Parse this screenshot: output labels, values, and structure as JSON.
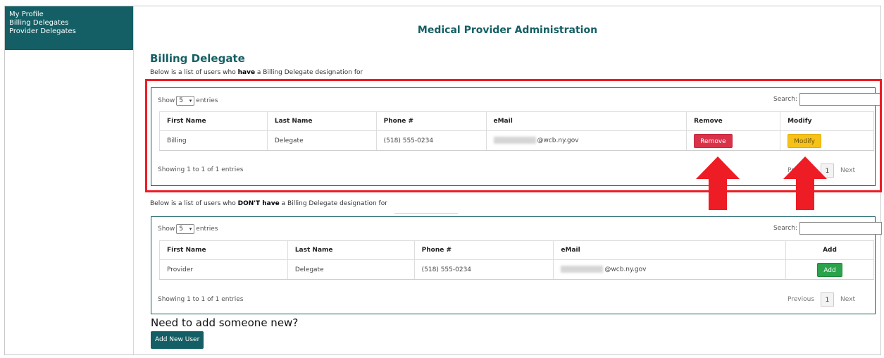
{
  "sidebar": {
    "items": [
      {
        "label": "My Profile"
      },
      {
        "label": "Billing Delegates"
      },
      {
        "label": "Provider Delegates"
      }
    ]
  },
  "header": {
    "title": "Medical Provider Administration"
  },
  "section": {
    "title": "Billing Delegate",
    "have_desc_prefix": "Below is a list of users who ",
    "have_desc_bold": "have",
    "have_desc_suffix": " a Billing Delegate designation for",
    "dont_desc_prefix": "Below is a list of users who ",
    "dont_desc_bold": "DON'T have",
    "dont_desc_suffix": " a Billing Delegate designation for"
  },
  "have_table": {
    "show_label": "Show",
    "entries_value": "5",
    "entries_label": "entries",
    "search_label": "Search:",
    "columns": [
      "First Name",
      "Last Name",
      "Phone #",
      "eMail",
      "Remove",
      "Modify"
    ],
    "rows": [
      {
        "first": "Billing",
        "last": "Delegate",
        "phone": "(518) 555-0234",
        "email": "@wcb.ny.gov",
        "remove": "Remove",
        "modify": "Modify"
      }
    ],
    "info": "Showing 1 to 1 of 1 entries",
    "previous": "Previous",
    "page": "1",
    "next": "Next"
  },
  "dont_table": {
    "show_label": "Show",
    "entries_value": "5",
    "entries_label": "entries",
    "search_label": "Search:",
    "columns": [
      "First Name",
      "Last Name",
      "Phone #",
      "eMail",
      "Add"
    ],
    "rows": [
      {
        "first": "Provider",
        "last": "Delegate",
        "phone": "(518) 555-0234",
        "email": "@wcb.ny.gov",
        "add": "Add"
      }
    ],
    "info": "Showing 1 to 1 of 1 entries",
    "previous": "Previous",
    "page": "1",
    "next": "Next"
  },
  "footer": {
    "need_title": "Need to add someone new?",
    "add_new_label": "Add New User"
  },
  "colors": {
    "brand": "#145f65",
    "remove": "#d9334a",
    "modify": "#f6c21a",
    "add": "#2aa34a",
    "highlight": "#ee1c24"
  }
}
